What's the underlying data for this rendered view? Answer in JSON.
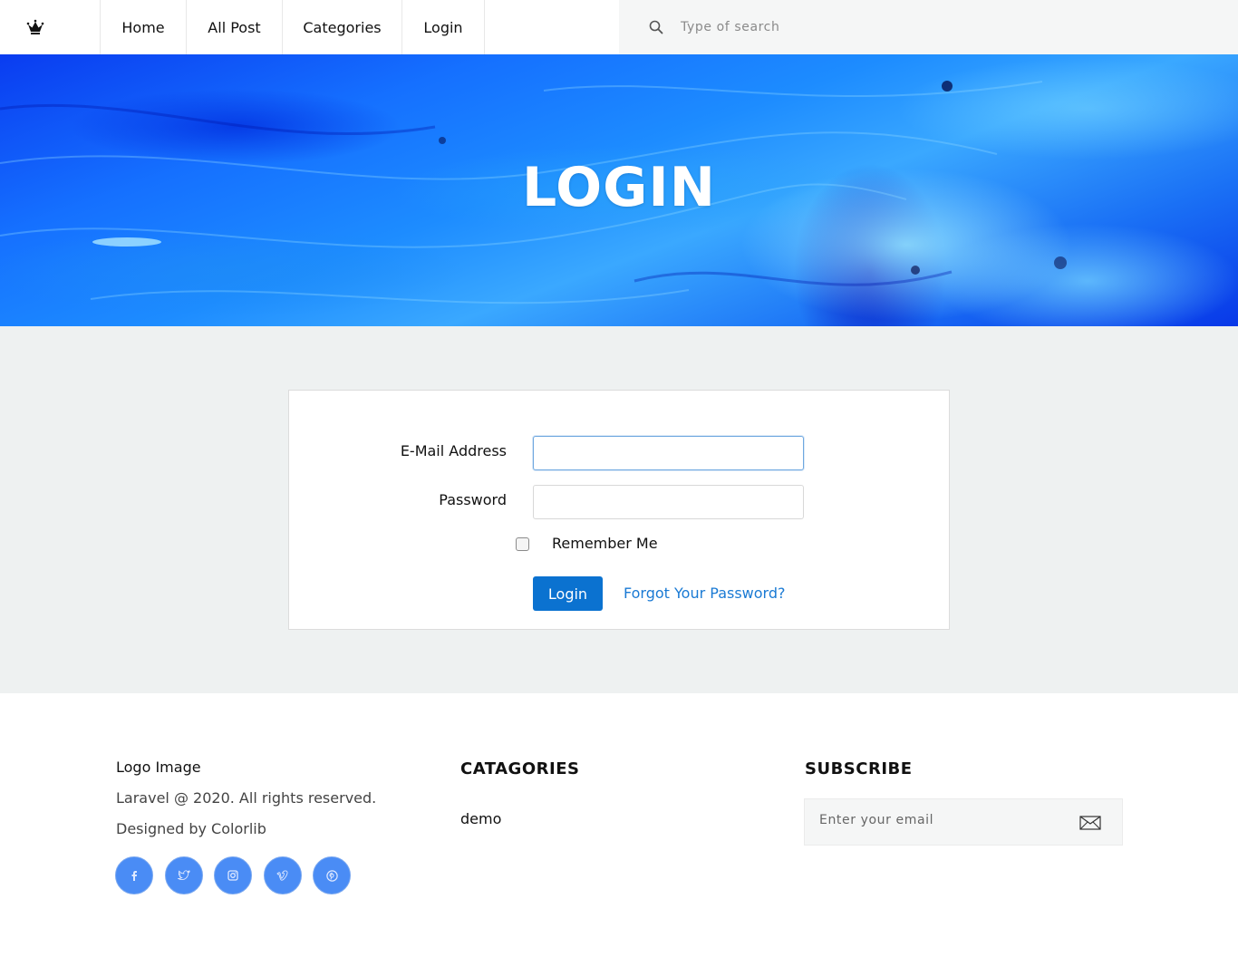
{
  "nav": {
    "logo_icon": "crown-icon",
    "items": [
      {
        "label": "Home"
      },
      {
        "label": "All Post"
      },
      {
        "label": "Categories"
      },
      {
        "label": "Login"
      }
    ],
    "search": {
      "placeholder": "Type of search",
      "icon": "search-icon"
    }
  },
  "hero": {
    "title": "LOGIN"
  },
  "login_form": {
    "email_label": "E-Mail Address",
    "email_value": "",
    "password_label": "Password",
    "password_value": "",
    "remember_label": "Remember Me",
    "remember_checked": false,
    "submit_label": "Login",
    "forgot_label": "Forgot Your Password?"
  },
  "footer": {
    "logo_text": "Logo Image",
    "copyright": "Laravel @ 2020. All rights reserved.",
    "designed_by": "Designed by Colorlib",
    "socials": [
      "facebook-icon",
      "twitter-icon",
      "instagram-icon",
      "vimeo-icon",
      "pinterest-icon"
    ],
    "categories_title": "CATAGORIES",
    "categories": [
      "demo"
    ],
    "subscribe_title": "SUBSCRIBE",
    "subscribe_placeholder": "Enter your email",
    "subscribe_icon": "envelope-icon"
  },
  "colors": {
    "accent": "#0b72d0",
    "link": "#1a7ad4",
    "social": "#4a8cf5",
    "page_bg": "#eef1f1"
  }
}
